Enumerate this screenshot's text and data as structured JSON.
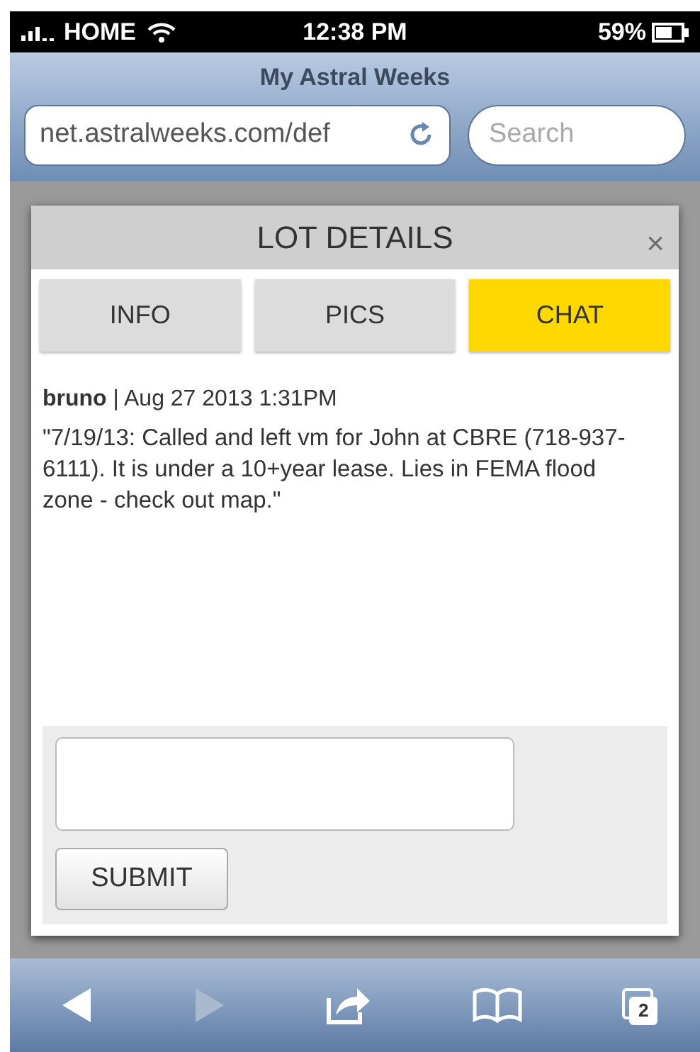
{
  "status_bar": {
    "carrier": "HOME",
    "time": "12:38 PM",
    "battery": "59%"
  },
  "browser": {
    "title": "My Astral Weeks",
    "url": "net.astralweeks.com/def",
    "search": {
      "placeholder": "Search"
    }
  },
  "dialog": {
    "title": "LOT DETAILS",
    "close": "×",
    "tabs": [
      {
        "label": "INFO",
        "selected": false
      },
      {
        "label": "PICS",
        "selected": false
      },
      {
        "label": "CHAT",
        "selected": true
      }
    ],
    "message": {
      "author": "bruno",
      "meta": " | Aug 27 2013 1:31PM",
      "text": "\"7/19/13: Called and left vm for John at CBRE (718-937-6111). It is under a 10+year lease. Lies in FEMA flood zone - check out map.\""
    },
    "submit": "SUBMIT"
  },
  "toolbar": [
    {
      "kind": "back",
      "disabled": false
    },
    {
      "kind": "forward",
      "disabled": true
    },
    {
      "kind": "share",
      "disabled": false
    },
    {
      "kind": "bookmarks",
      "disabled": false
    },
    {
      "kind": "tabs",
      "disabled": false,
      "count": "2"
    }
  ]
}
